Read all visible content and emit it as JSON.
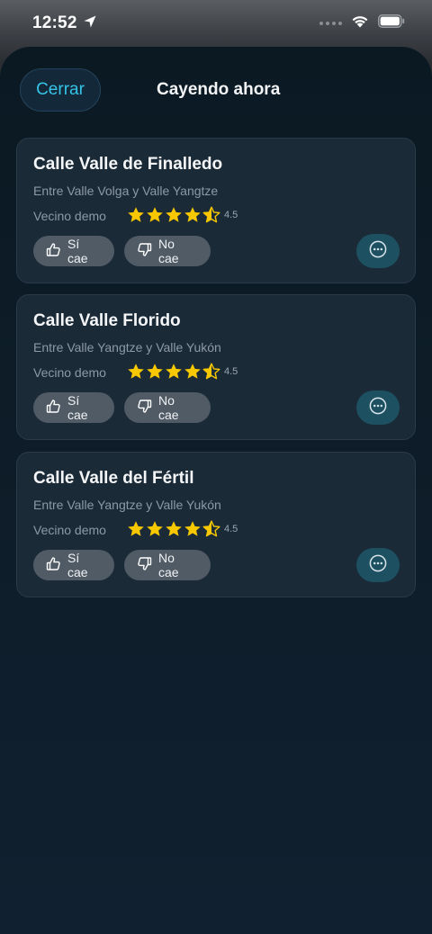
{
  "status_bar": {
    "time": "12:52"
  },
  "header": {
    "close_label": "Cerrar",
    "title": "Cayendo ahora"
  },
  "colors": {
    "accent": "#35c4e6",
    "star": "#f7c800",
    "card_bg": "#1b2a37",
    "button_bg": "#505b66",
    "more_bg": "#1d5060"
  },
  "cards": [
    {
      "title": "Calle Valle de Finalledo",
      "subtitle": "Entre Valle Volga y Valle Yangtze",
      "author": "Vecino demo",
      "rating": 4.5,
      "rating_label": "4.5",
      "yes_label": "Sí cae",
      "no_label": "No cae"
    },
    {
      "title": "Calle Valle Florido",
      "subtitle": "Entre Valle Yangtze y Valle Yukón",
      "author": "Vecino demo",
      "rating": 4.5,
      "rating_label": "4.5",
      "yes_label": "Sí cae",
      "no_label": "No cae"
    },
    {
      "title": "Calle Valle del Fértil",
      "subtitle": "Entre Valle Yangtze y Valle Yukón",
      "author": "Vecino demo",
      "rating": 4.5,
      "rating_label": "4.5",
      "yes_label": "Sí cae",
      "no_label": "No cae"
    }
  ],
  "icons": {
    "status": [
      "location-arrow-icon",
      "cellular-dots-icon",
      "wifi-icon",
      "battery-icon"
    ],
    "card": [
      "star-icon",
      "half-star-icon",
      "thumbs-up-icon",
      "thumbs-down-icon",
      "more-dots-icon"
    ]
  }
}
